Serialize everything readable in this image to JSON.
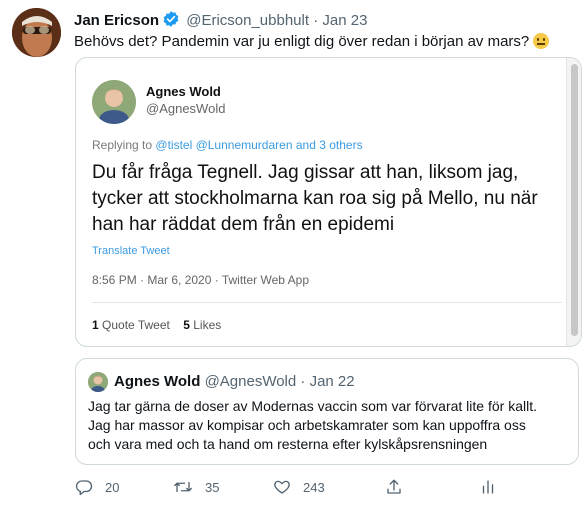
{
  "tweet": {
    "author_name": "Jan Ericson",
    "author_handle": "@Ericson_ubbhult",
    "separator": "·",
    "date": "Jan 23",
    "text": "Behövs det? Pandemin var ju enligt dig över redan i början av mars?",
    "emoji_icon": "neutral-face-emoji-icon"
  },
  "screenshot": {
    "author_name": "Agnes Wold",
    "author_handle": "@AgnesWold",
    "replying_prefix": "Replying to",
    "replying_mentions": "@tistel @Lunnemurdaren",
    "replying_and": "and",
    "replying_others": "3 others",
    "text_lines": [
      "Du får fråga Tegnell. Jag gissar att han, liksom jag,",
      "tycker att stockholmarna kan roa sig på Mello, nu när",
      "han har räddat dem från en epidemi"
    ],
    "translate_label": "Translate Tweet",
    "meta": "8:56 PM · Mar 6, 2020 · Twitter Web App",
    "quote_tweet_count": "1",
    "quote_tweet_label": "Quote Tweet",
    "likes_count": "5",
    "likes_label": "Likes"
  },
  "quoted": {
    "author_name": "Agnes Wold",
    "author_handle": "@AgnesWold",
    "separator": "·",
    "date": "Jan 22",
    "text_lines": [
      "Jag tar gärna de doser av Modernas vaccin som var förvarat lite för kallt.",
      "Jag har massor av kompisar och arbetskamrater som kan uppoffra oss",
      "och vara med och ta hand om resterna efter kylskåpsrensningen"
    ]
  },
  "actions": {
    "reply_count": "20",
    "retweet_count": "35",
    "like_count": "243",
    "icons": [
      "reply-icon",
      "retweet-icon",
      "like-icon",
      "analytics-icon"
    ]
  },
  "colors": {
    "text": "#0f1419",
    "muted": "#536471",
    "link": "#3b9be0",
    "verified": "#1d9bf0",
    "border": "#cfd9de"
  }
}
